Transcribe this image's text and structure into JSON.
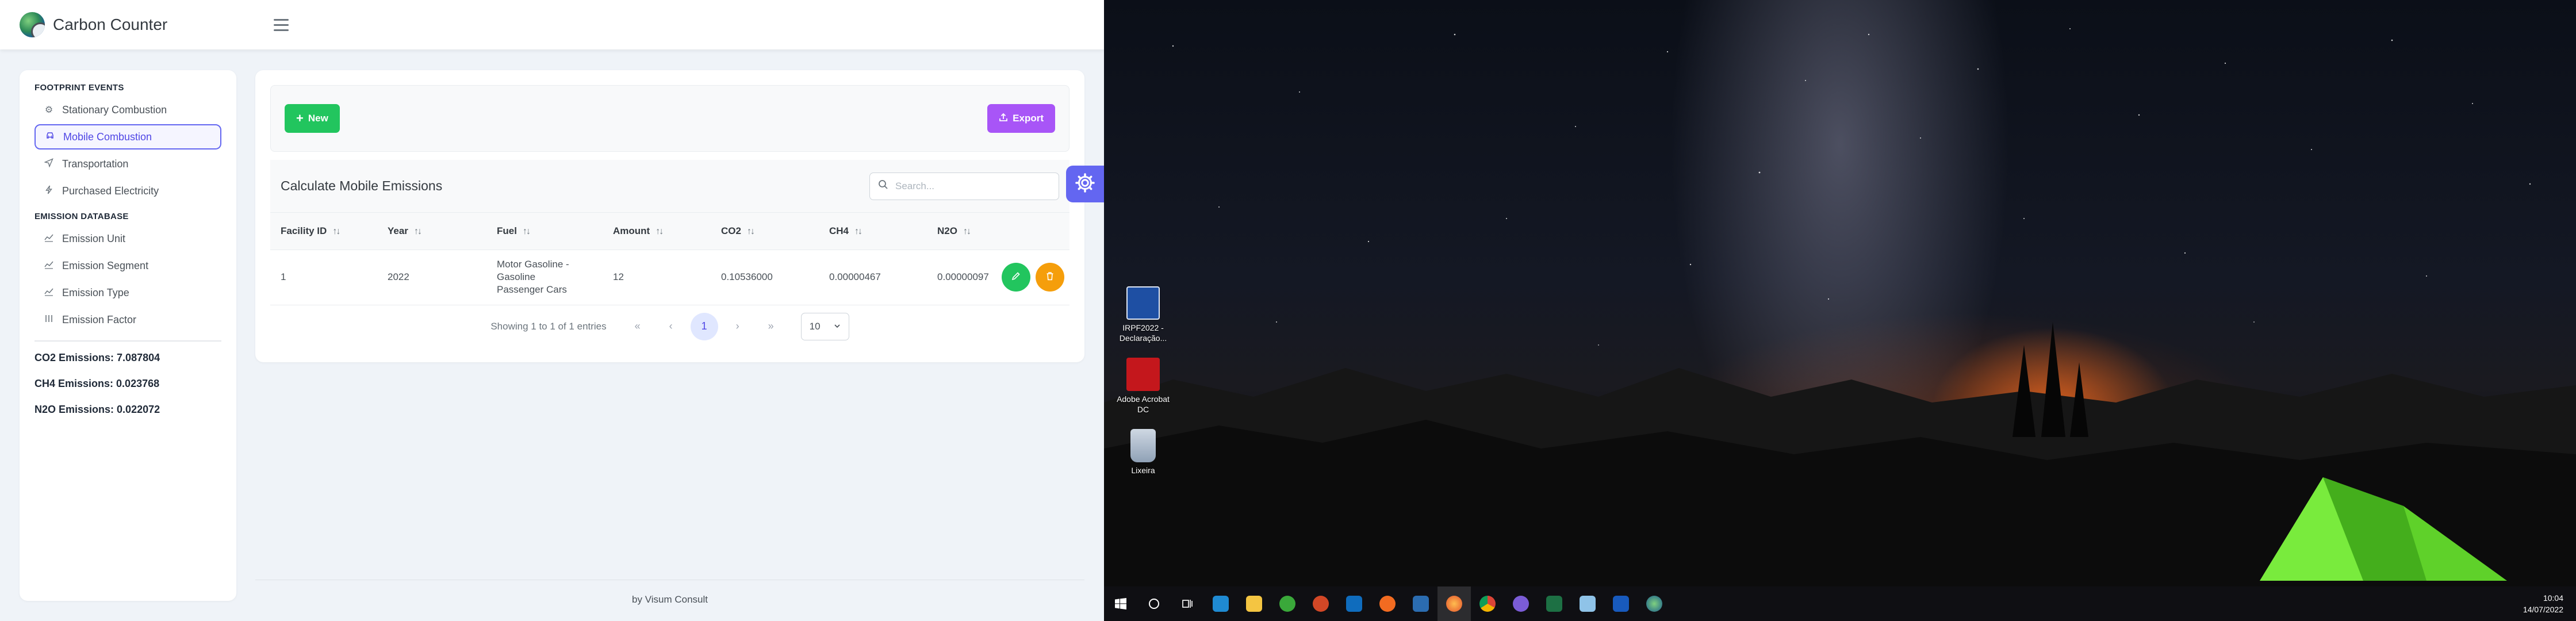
{
  "app": {
    "brand_name": "Carbon Counter"
  },
  "sidebar": {
    "sections": [
      {
        "title": "FOOTPRINT EVENTS"
      },
      {
        "title": "EMISSION DATABASE"
      }
    ],
    "footprint_items": [
      {
        "label": "Stationary Combustion",
        "icon": "gear-icon"
      },
      {
        "label": "Mobile Combustion",
        "icon": "car-icon",
        "active": true
      },
      {
        "label": "Transportation",
        "icon": "send-icon"
      },
      {
        "label": "Purchased Electricity",
        "icon": "bolt-icon"
      }
    ],
    "database_items": [
      {
        "label": "Emission Unit",
        "icon": "chart-icon"
      },
      {
        "label": "Emission Segment",
        "icon": "chart-icon"
      },
      {
        "label": "Emission Type",
        "icon": "chart-icon"
      },
      {
        "label": "Emission Factor",
        "icon": "bars-icon"
      }
    ],
    "totals": [
      "CO2 Emissions: 7.087804",
      "CH4 Emissions: 0.023768",
      "N2O Emissions: 0.022072"
    ]
  },
  "toolbar": {
    "new_label": "New",
    "export_label": "Export"
  },
  "table": {
    "title": "Calculate Mobile Emissions",
    "search_placeholder": "Search...",
    "columns": [
      "Facility ID",
      "Year",
      "Fuel",
      "Amount",
      "CO2",
      "CH4",
      "N2O"
    ],
    "rows": [
      [
        "1",
        "2022",
        "Motor Gasoline - Gasoline Passenger Cars",
        "12",
        "0.10536000",
        "0.00000467",
        "0.00000097"
      ]
    ],
    "pagination": {
      "summary": "Showing 1 to 1 of 1 entries",
      "current_page": "1",
      "rows_per_page": "10"
    }
  },
  "footer": {
    "text": "by Visum Consult"
  },
  "desktop": {
    "icons": [
      {
        "label": "IRPF2022 - Declaração...",
        "icon": "irpf-icon"
      },
      {
        "label": "Adobe Acrobat DC",
        "icon": "acrobat-icon"
      },
      {
        "label": "Lixeira",
        "icon": "recycle-bin-icon"
      }
    ],
    "taskbar": {
      "apps": [
        "vscode-icon",
        "file-explorer-icon",
        "app-green-icon",
        "powerpoint-icon",
        "outlook-icon",
        "app-orange-icon",
        "app-blue-icon",
        "firefox-icon",
        "chrome-icon",
        "app-purple-icon",
        "excel-icon",
        "notepad-icon",
        "word-icon",
        "carbon-counter-icon"
      ],
      "time": "10:04",
      "date": "14/07/2022"
    }
  }
}
